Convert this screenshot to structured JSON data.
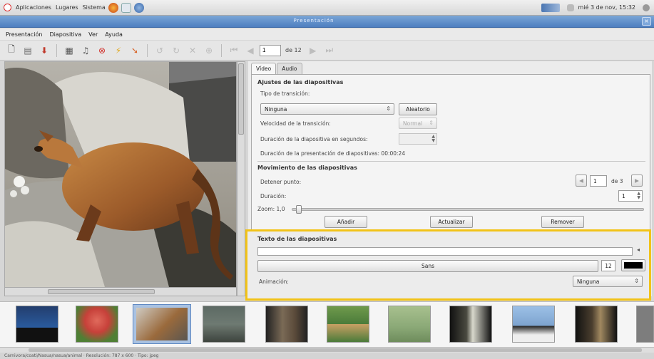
{
  "panel": {
    "menus": [
      "Aplicaciones",
      "Lugares",
      "Sistema"
    ],
    "clock": "mié 3 de nov, 15:32"
  },
  "window": {
    "title": "Presentación"
  },
  "menubar": [
    "Presentación",
    "Diapositiva",
    "Ver",
    "Ayuda"
  ],
  "toolbar": {
    "page_value": "1",
    "page_of": "de 12"
  },
  "tabs": [
    {
      "label": "Vídeo",
      "active": true
    },
    {
      "label": "Audio",
      "active": false
    }
  ],
  "slide_settings": {
    "title": "Ajustes de las diapositivas",
    "transition_label": "Tipo de transición:",
    "transition_value": "Ninguna",
    "random_button": "Aleatorio",
    "speed_label": "Velocidad de la transición:",
    "speed_value": "Normal",
    "duration_label": "Duración de la diapositiva en segundos:",
    "presentation_duration": "Duración de la presentación de diapositivas: 00:00:24"
  },
  "motion": {
    "title": "Movimiento de las diapositivas",
    "stop_point_label": "Detener punto:",
    "stop_point_value": "1",
    "stop_point_of": "de 3",
    "duration_label": "Duración:",
    "duration_value": "1",
    "zoom_label": "Zoom: 1,0",
    "zoom_level": 0.02,
    "add_button": "Añadir",
    "update_button": "Actualizar",
    "remove_button": "Remover"
  },
  "slide_text": {
    "title": "Texto de las diapositivas",
    "text_value": "",
    "font_button": "Sans",
    "font_size": "12",
    "color": "#000000",
    "animation_label": "Animación:",
    "animation_value": "Ninguna"
  },
  "thumbnails": [
    {
      "name": "whale",
      "bg": "#2a5b9e"
    },
    {
      "name": "flower",
      "bg": "#c7413a"
    },
    {
      "name": "coati",
      "bg": "#9a6a3c"
    },
    {
      "name": "rhino",
      "bg": "#6e7a72"
    },
    {
      "name": "owl",
      "bg": "#5a4a3a"
    },
    {
      "name": "leopard",
      "bg": "#4b7b3a"
    },
    {
      "name": "bird",
      "bg": "#8aa876"
    },
    {
      "name": "lemur",
      "bg": "#3a3a34"
    },
    {
      "name": "penguins",
      "bg": "#7da3cf"
    },
    {
      "name": "monkey",
      "bg": "#4a3e2e"
    },
    {
      "name": "partial",
      "bg": "#7d7d7d"
    }
  ],
  "statusbar": "Carnivora/coati/Nasua/nasua/animal · Resolución: 787 x 600 · Tipo: jpeg"
}
